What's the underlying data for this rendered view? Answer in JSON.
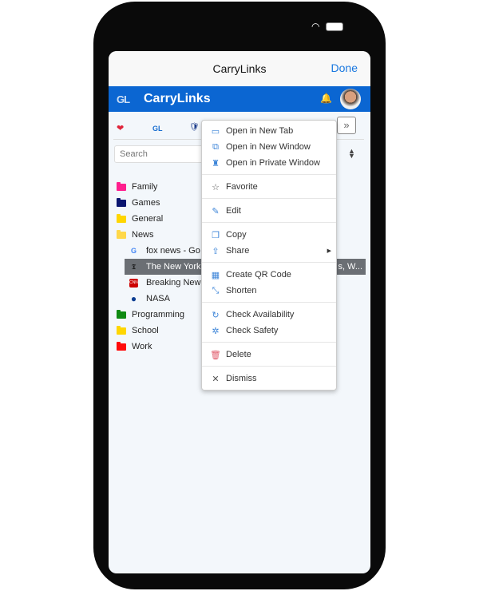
{
  "status": {
    "wifi_icon": "wifi-icon",
    "battery_icon": "battery-icon"
  },
  "navbar": {
    "title": "CarryLinks",
    "done": "Done"
  },
  "appbar": {
    "logo": "GL",
    "title": "CarryLinks",
    "color": "#0b66d2"
  },
  "toolbar": {
    "favorites": [
      {
        "icon": "heart-icon",
        "glyph": "❤"
      },
      {
        "icon": "carrylinks-icon",
        "glyph": "GL"
      },
      {
        "icon": "nfl-icon",
        "glyph": "🛡"
      }
    ],
    "more": "»"
  },
  "search": {
    "placeholder": "Search"
  },
  "tree": {
    "folders_before": [
      {
        "label": "Family",
        "color": "#ff1f8e"
      },
      {
        "label": "Games",
        "color": "#0b1670"
      },
      {
        "label": "General",
        "color": "#ffd600"
      },
      {
        "label": "News",
        "color": "#ffd84a",
        "open": true
      }
    ],
    "links": [
      {
        "label": "fox news - Go",
        "icon": "google-icon",
        "glyph": "G"
      },
      {
        "label": "The New York",
        "tail": "s, W...",
        "icon": "nyt-icon",
        "glyph": "𝕿",
        "selected": true
      },
      {
        "label": "Breaking New",
        "icon": "cnn-icon",
        "glyph": "CNN"
      },
      {
        "label": "NASA",
        "icon": "nasa-icon",
        "glyph": "●"
      }
    ],
    "folders_after": [
      {
        "label": "Programming",
        "color": "#0f8a12"
      },
      {
        "label": "School",
        "color": "#ffd600"
      },
      {
        "label": "Work",
        "color": "#ff0a0a"
      }
    ]
  },
  "menu": {
    "groups": [
      [
        {
          "label": "Open in New Tab",
          "icon": "new-tab-icon",
          "glyph": "▭"
        },
        {
          "label": "Open in New Window",
          "icon": "new-window-icon",
          "glyph": "⧉"
        },
        {
          "label": "Open in Private Window",
          "icon": "private-window-icon",
          "glyph": "♜"
        }
      ],
      [
        {
          "label": "Favorite",
          "icon": "star-icon",
          "glyph": "☆"
        }
      ],
      [
        {
          "label": "Edit",
          "icon": "edit-icon",
          "glyph": "✎"
        }
      ],
      [
        {
          "label": "Copy",
          "icon": "copy-icon",
          "glyph": "❐"
        },
        {
          "label": "Share",
          "icon": "share-icon",
          "glyph": "⇪",
          "submenu": true
        }
      ],
      [
        {
          "label": "Create QR Code",
          "icon": "qr-code-icon",
          "glyph": "▦"
        },
        {
          "label": "Shorten",
          "icon": "shorten-icon",
          "glyph": "⤡"
        }
      ],
      [
        {
          "label": "Check Availability",
          "icon": "refresh-icon",
          "glyph": "↻"
        },
        {
          "label": "Check Safety",
          "icon": "bug-icon",
          "glyph": "✲"
        }
      ],
      [
        {
          "label": "Delete",
          "icon": "trash-icon",
          "glyph": "🗑"
        }
      ],
      [
        {
          "label": "Dismiss",
          "icon": "close-icon",
          "glyph": "✕"
        }
      ]
    ]
  }
}
